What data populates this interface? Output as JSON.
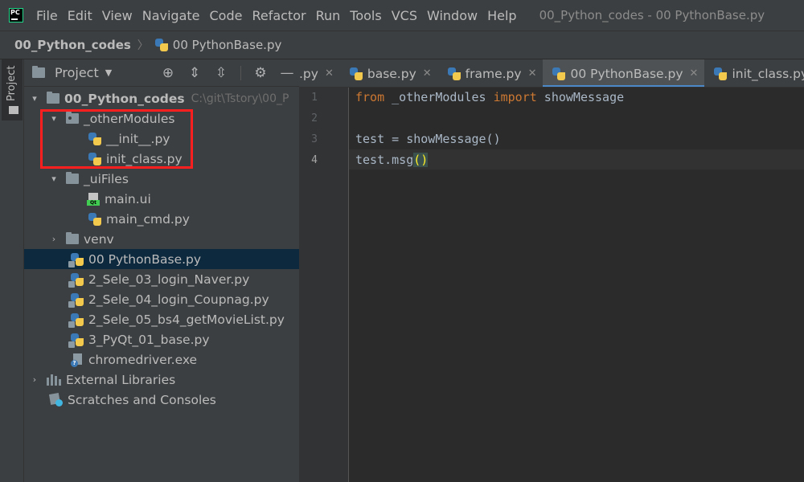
{
  "menubar": {
    "logo_text": "PC",
    "items": [
      "File",
      "Edit",
      "View",
      "Navigate",
      "Code",
      "Refactor",
      "Run",
      "Tools",
      "VCS",
      "Window",
      "Help"
    ],
    "title": "00_Python_codes - 00 PythonBase.py"
  },
  "navbar": {
    "root": "00_Python_codes",
    "file": "00 PythonBase.py"
  },
  "toolstrip": {
    "project_label": "Project"
  },
  "project": {
    "header_title": "Project",
    "tree": {
      "root_label": "00_Python_codes",
      "root_path": "C:\\git\\Tstory\\00_P",
      "other_modules": "_otherModules",
      "init_file": "__init__.py",
      "init_class_file": "init_class.py",
      "ui_files": "_uiFiles",
      "main_ui": "main.ui",
      "main_cmd": "main_cmd.py",
      "venv": "venv",
      "python_base": "00 PythonBase.py",
      "sele03": "2_Sele_03_login_Naver.py",
      "sele04": "2_Sele_04_login_Coupnag.py",
      "sele05": "2_Sele_05_bs4_getMovieList.py",
      "pyqt01": "3_PyQt_01_base.py",
      "chromedriver": "chromedriver.exe",
      "ext_libs": "External Libraries",
      "scratches": "Scratches and Consoles"
    }
  },
  "tabs": [
    {
      "label": ".py"
    },
    {
      "label": "base.py"
    },
    {
      "label": "frame.py"
    },
    {
      "label": "00 PythonBase.py"
    },
    {
      "label": "init_class.py"
    }
  ],
  "editor": {
    "line_numbers": [
      "1",
      "2",
      "3",
      "4"
    ],
    "line1_kw1": "from",
    "line1_mod": " _otherModules ",
    "line1_kw2": "import",
    "line1_name": " showMessage",
    "line3": "test = showMessage()",
    "line4_code": "test.msg",
    "line4_open": "(",
    "line4_close": ")"
  },
  "colors": {
    "highlight_box": "#ff1f1f",
    "active_tab_underline": "#4a88c7",
    "keyword": "#cc7832"
  }
}
